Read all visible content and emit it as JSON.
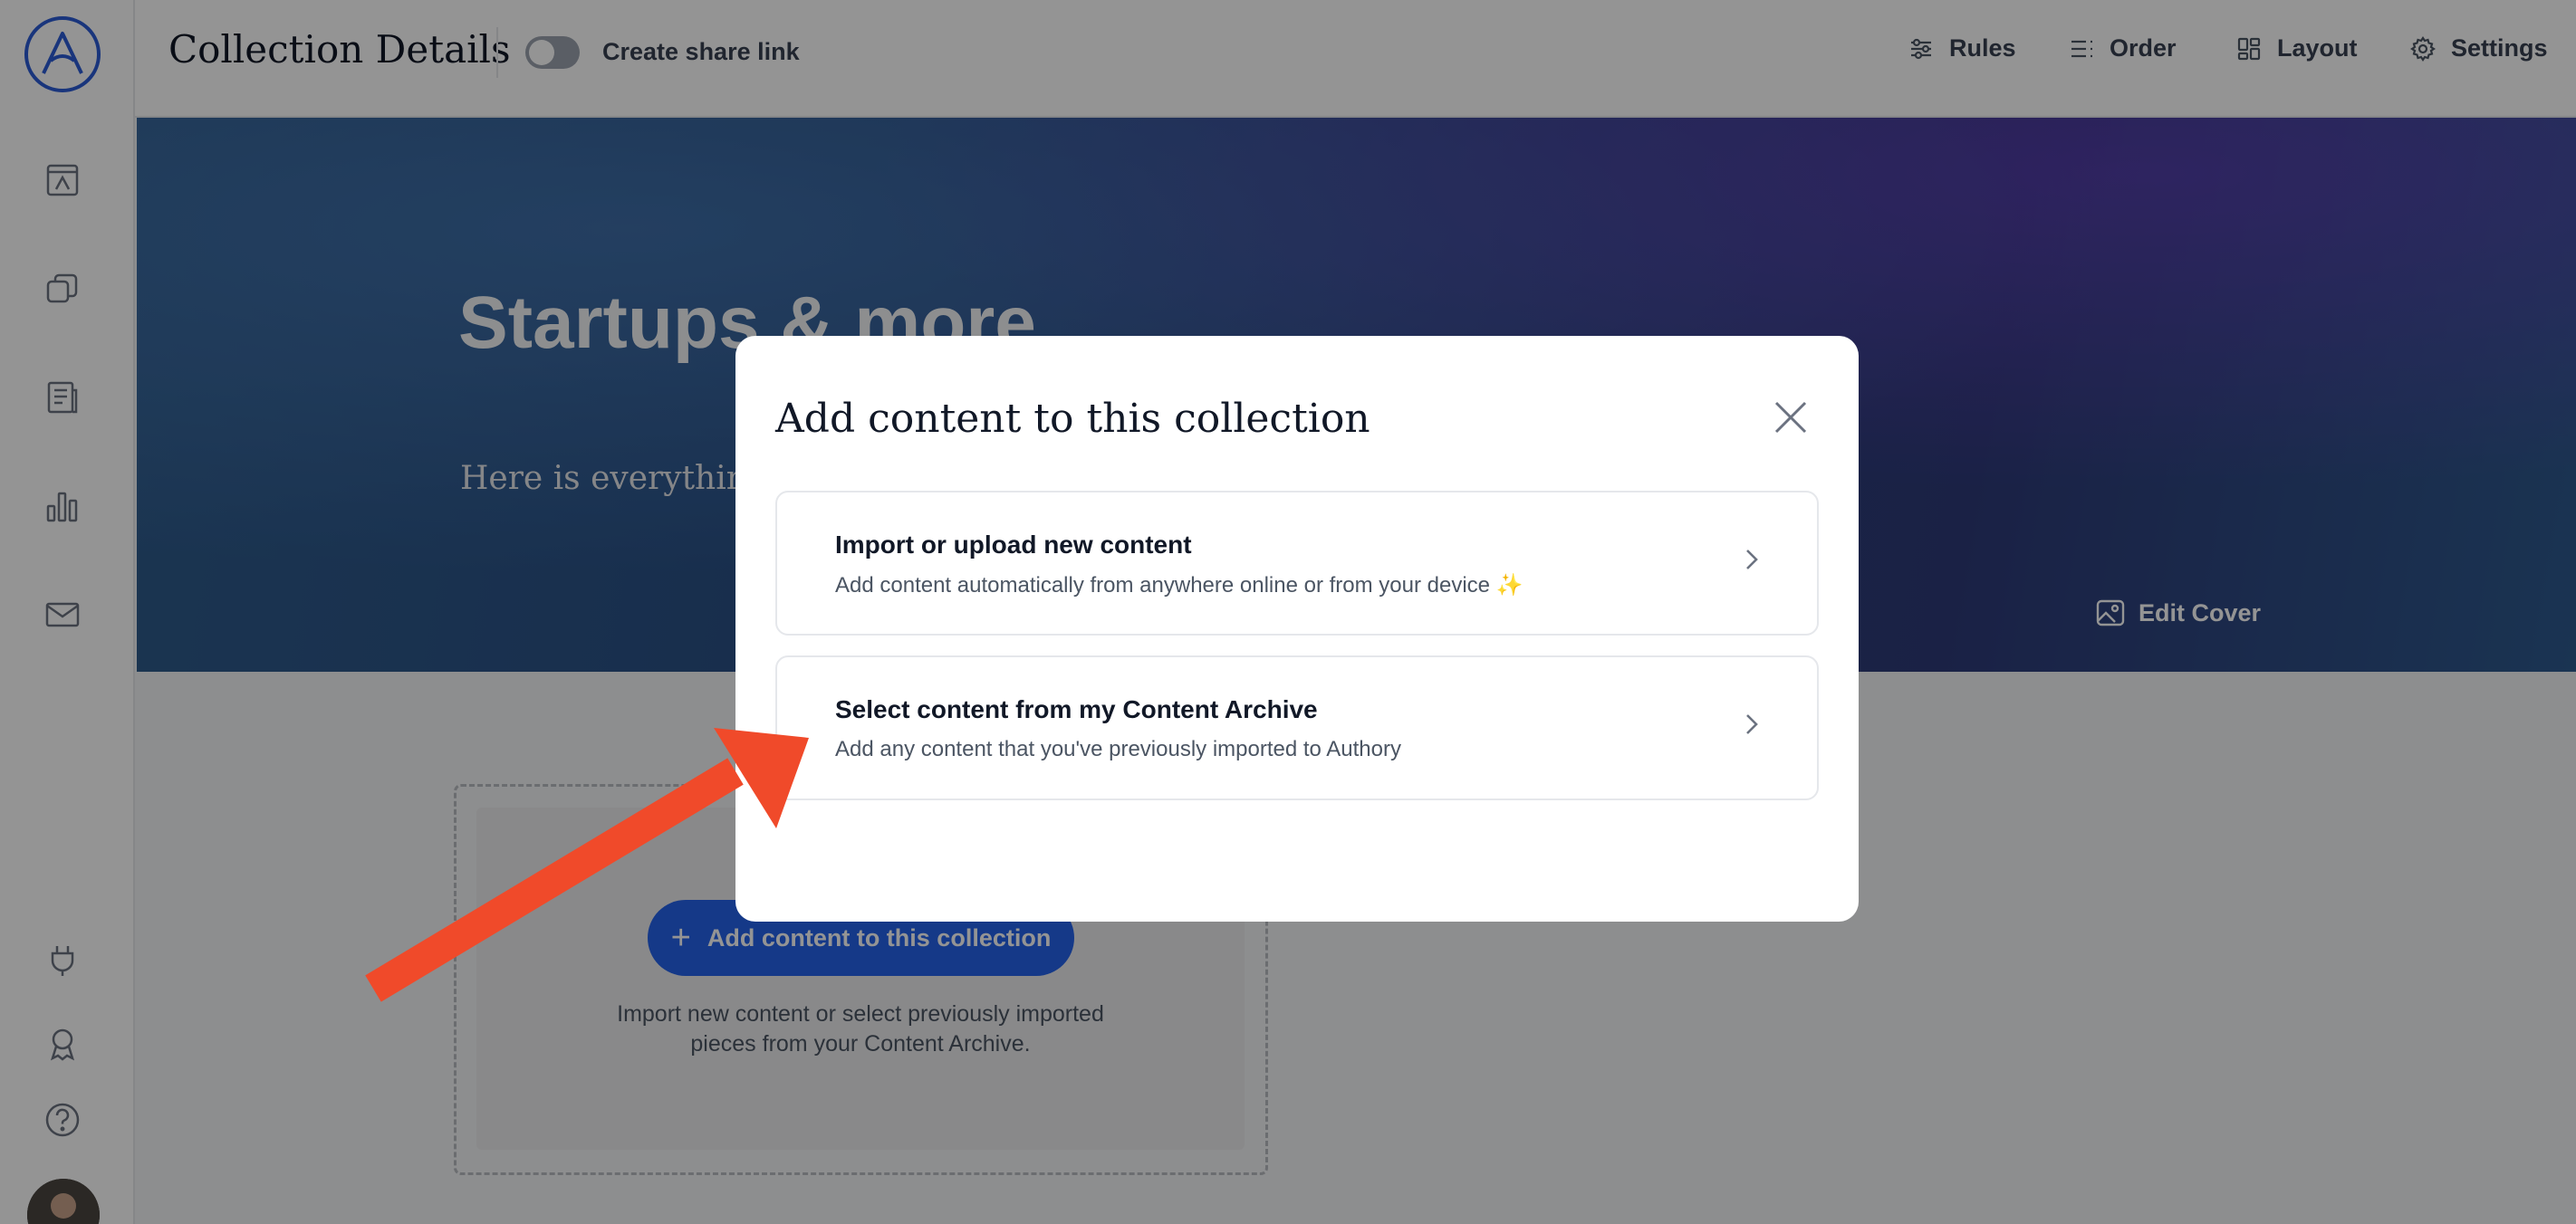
{
  "header": {
    "title": "Collection Details",
    "share_label": "Create share link",
    "actions": [
      {
        "label": "Rules",
        "icon": "sliders-icon"
      },
      {
        "label": "Order",
        "icon": "list-order-icon"
      },
      {
        "label": "Layout",
        "icon": "layout-grid-icon"
      },
      {
        "label": "Settings",
        "icon": "gear-icon"
      }
    ]
  },
  "sidebar": {
    "logo": "authory-logo",
    "top_icons": [
      "portfolio-icon",
      "collections-icon",
      "content-archive-icon",
      "analytics-icon",
      "mail-icon"
    ],
    "bottom_icons": [
      "plug-icon",
      "award-icon",
      "help-icon"
    ]
  },
  "cover": {
    "title": "Startups & more",
    "subtitle": "Here is everything",
    "edit_label": "Edit Cover"
  },
  "empty_state": {
    "button_label": "Add content to this collection",
    "description_line1": "Import new content or select previously imported",
    "description_line2": "pieces from your Content Archive."
  },
  "modal": {
    "title": "Add content to this collection",
    "options": [
      {
        "title": "Import or upload new content",
        "description": "Add content automatically from anywhere online or from your device ✨"
      },
      {
        "title": "Select content from my Content Archive",
        "description": "Add any content that you've previously imported to Authory"
      }
    ]
  },
  "colors": {
    "primary": "#2563eb",
    "annotation_arrow": "#f04a2a",
    "logo": "#2b5cd6"
  }
}
